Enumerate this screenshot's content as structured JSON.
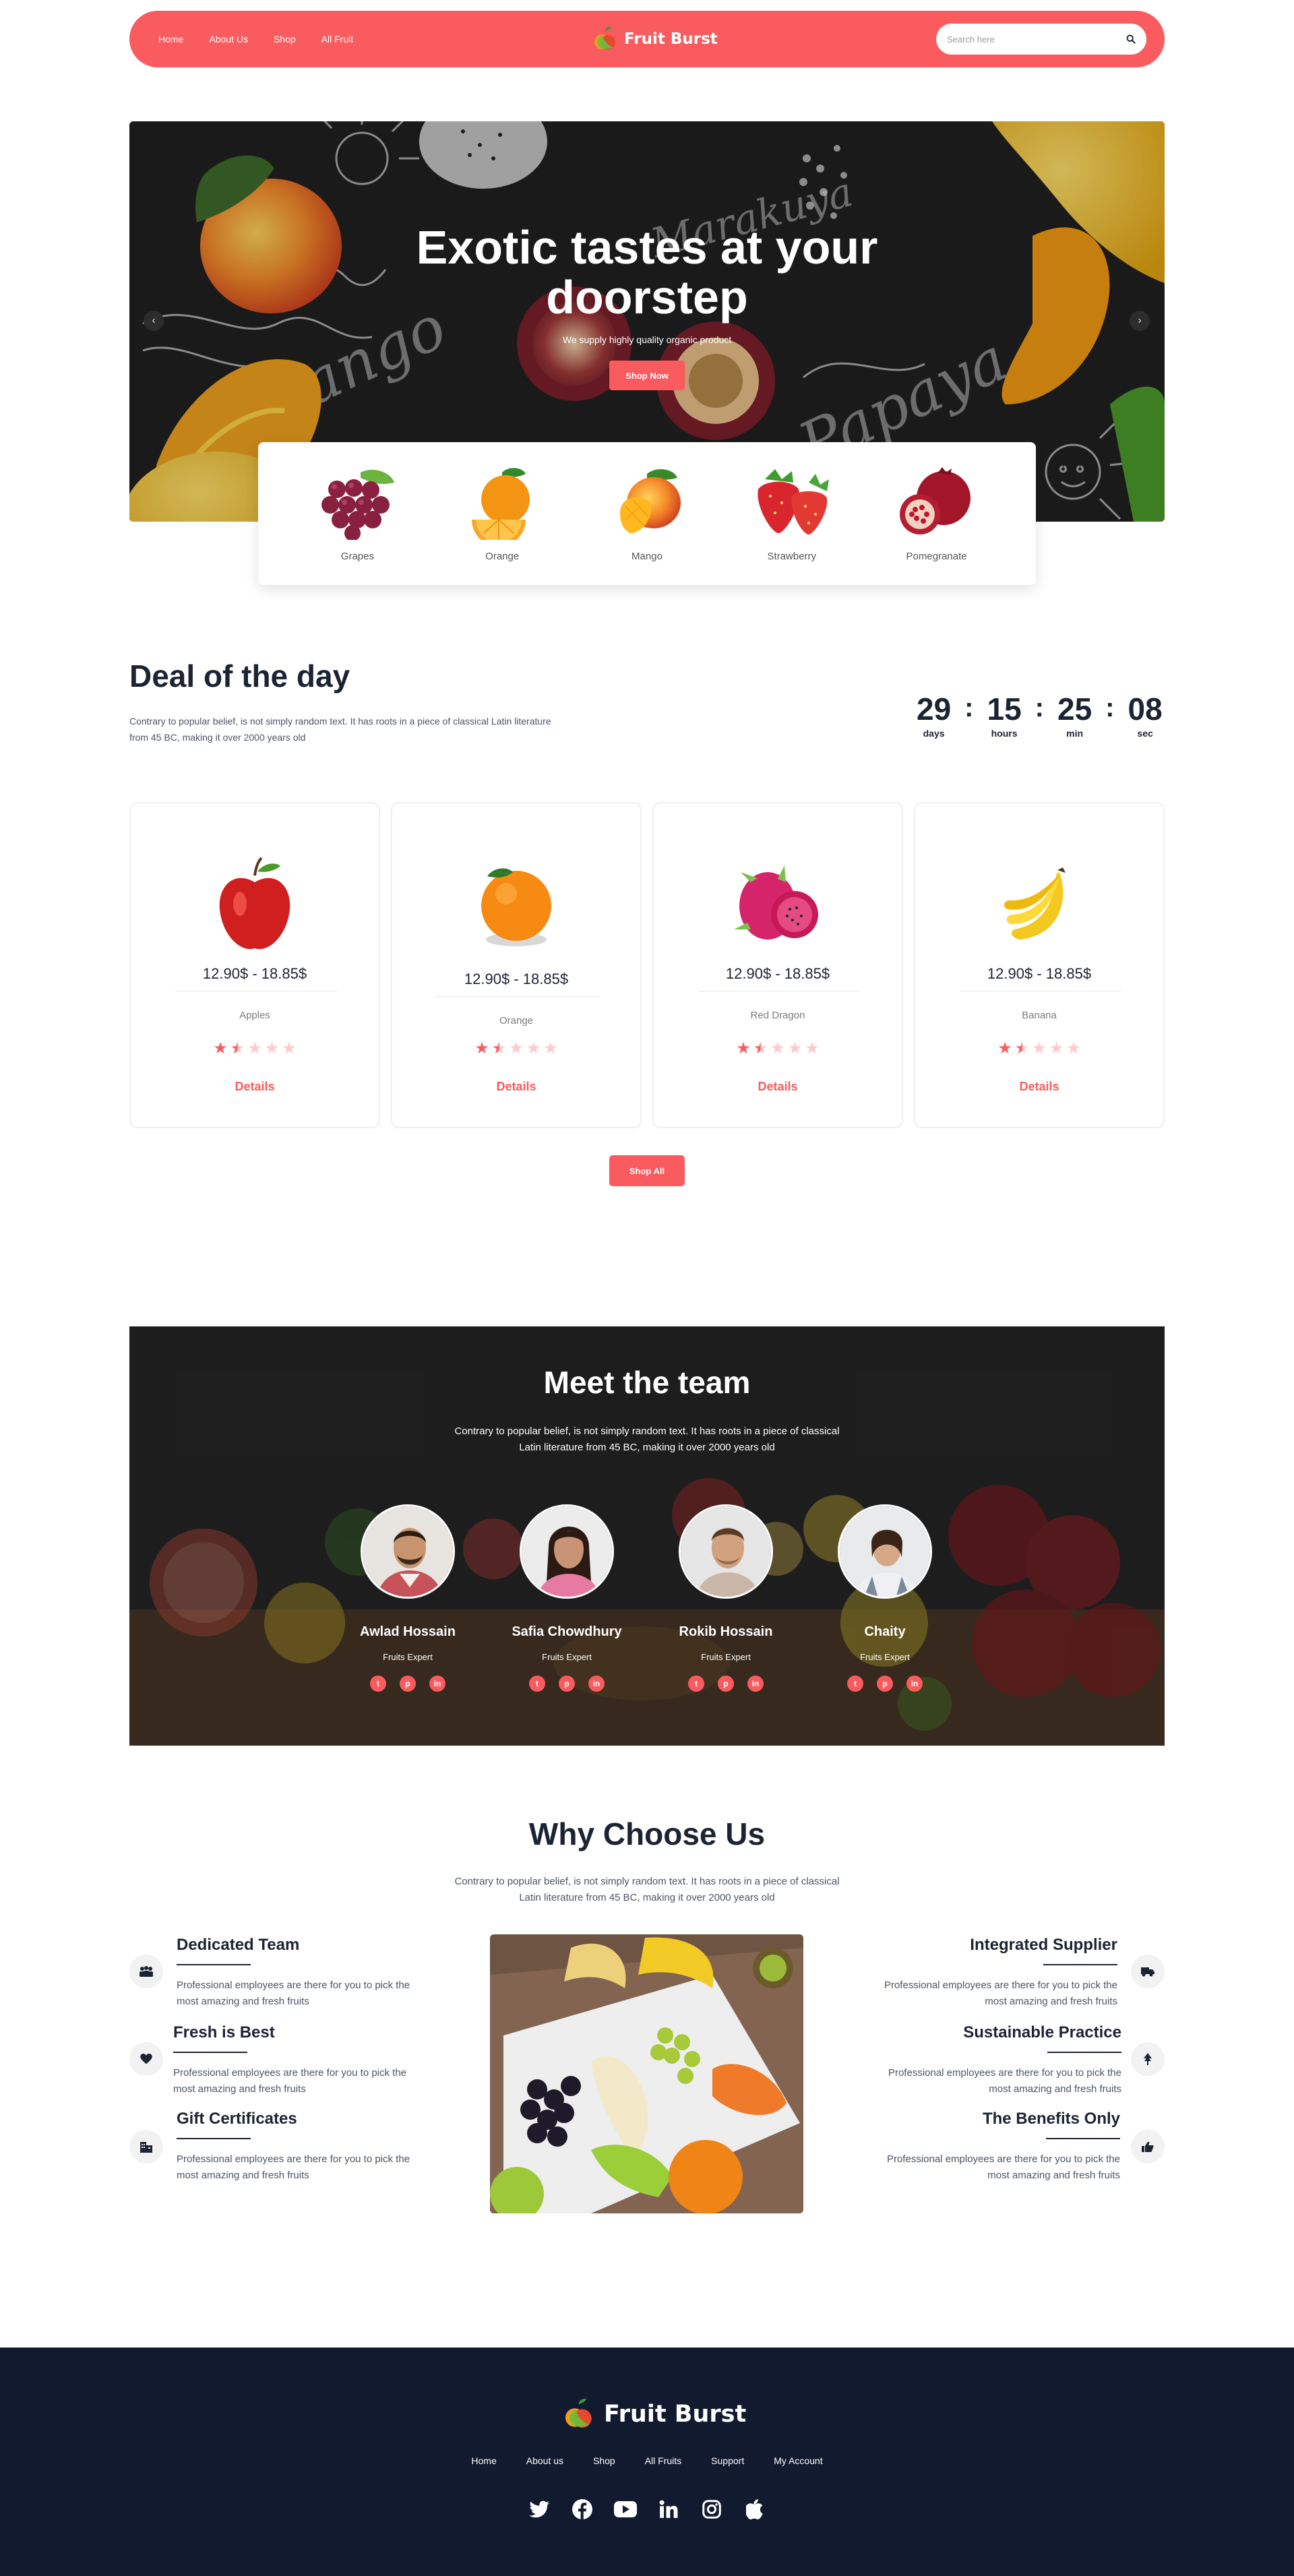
{
  "nav": {
    "links": [
      "Home",
      "About Us",
      "Shop",
      "All Fruit"
    ],
    "brand": "Fruit Burst",
    "search_placeholder": "Search here"
  },
  "hero": {
    "title_line1": "Exotic tastes at your",
    "title_line2": "doorstep",
    "subtitle": "We supply highly quality organic product",
    "cta": "Shop Now",
    "prev_arrow": "‹",
    "next_arrow": "›"
  },
  "categories": [
    "Grapes",
    "Orange",
    "Mango",
    "Strawberry",
    "Pomegranate"
  ],
  "deal": {
    "title": "Deal of the day",
    "text": "Contrary to popular belief, is not simply random text. It has roots in a piece of classical Latin literature from 45 BC, making it over 2000 years old",
    "timer": {
      "days": "29",
      "hours": "15",
      "min": "25",
      "sec": "08",
      "days_label": "days",
      "hours_label": "hours",
      "min_label": "min",
      "sec_label": "sec",
      "separator": ":"
    },
    "products": [
      {
        "price": "12.90$ - 18.85$",
        "name": "Apples",
        "rating": 1.5,
        "link": "Details"
      },
      {
        "price": "12.90$ - 18.85$",
        "name": "Orange",
        "rating": 1.5,
        "link": "Details"
      },
      {
        "price": "12.90$ - 18.85$",
        "name": "Red Dragon",
        "rating": 1.5,
        "link": "Details"
      },
      {
        "price": "12.90$ - 18.85$",
        "name": "Banana",
        "rating": 1.5,
        "link": "Details"
      }
    ],
    "shop_all": "Shop All"
  },
  "team": {
    "title": "Meet the team",
    "text": "Contrary to popular belief, is not simply random text. It has roots in a piece of classical Latin literature from 45 BC, making it over 2000 years old",
    "members": [
      {
        "name": "Awlad Hossain",
        "role": "Fruits Expert"
      },
      {
        "name": "Safia Chowdhury",
        "role": "Fruits Expert"
      },
      {
        "name": "Rokib Hossain",
        "role": "Fruits Expert"
      },
      {
        "name": "Chaity",
        "role": "Fruits Expert"
      }
    ]
  },
  "why": {
    "title": "Why Choose Us",
    "text": "Contrary to popular belief, is not simply random text. It has roots in a piece of classical Latin literature from 45 BC, making it over 2000 years old",
    "left": [
      {
        "title": "Dedicated Team",
        "desc": "Professional employees are there for you to pick the most amazing and fresh fruits",
        "icon": "team-icon"
      },
      {
        "title": "Fresh is Best",
        "desc": "Professional employees are there for you to pick the most amazing and fresh fruits",
        "icon": "heart-icon"
      },
      {
        "title": "Gift Certificates",
        "desc": "Professional employees are there for you to pick the most amazing and fresh fruits",
        "icon": "building-icon"
      }
    ],
    "right": [
      {
        "title": "Integrated Supplier",
        "desc": "Professional employees are there for you to pick the most amazing and fresh fruits",
        "icon": "truck-icon"
      },
      {
        "title": "Sustainable Practice",
        "desc": "Professional employees are there for you to pick the most amazing and fresh fruits",
        "icon": "tree-icon"
      },
      {
        "title": "The Benefits Only",
        "desc": "Professional employees are there for you to pick the most amazing and fresh fruits",
        "icon": "thumbs-up-icon"
      }
    ]
  },
  "footer": {
    "brand": "Fruit Burst",
    "links": [
      "Home",
      "About us",
      "Shop",
      "All Fruits",
      "Support",
      "My Account"
    ],
    "socials": [
      "twitter-icon",
      "facebook-icon",
      "youtube-icon",
      "linkedin-icon",
      "instagram-icon",
      "apple-icon"
    ]
  },
  "colors": {
    "accent": "#f95b5f",
    "dark": "#1c2333",
    "footer_bg": "#121a30"
  }
}
